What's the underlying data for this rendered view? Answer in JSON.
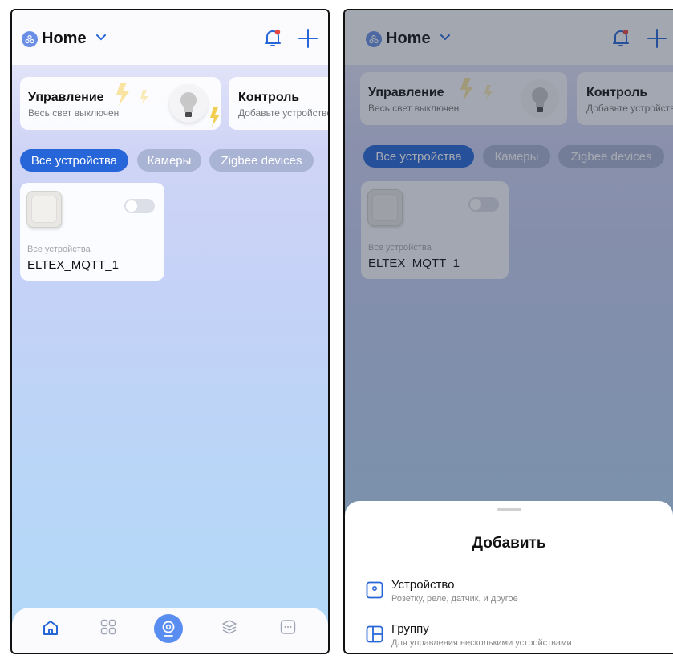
{
  "header": {
    "title": "Home"
  },
  "scene_cards": [
    {
      "title": "Управление",
      "subtitle": "Весь свет выключен"
    },
    {
      "title": "Контроль",
      "subtitle": "Добавьте устройство"
    }
  ],
  "tabs": [
    {
      "label": "Все устройства",
      "active": true
    },
    {
      "label": "Камеры",
      "active": false
    },
    {
      "label": "Zigbee devices",
      "active": false
    }
  ],
  "device": {
    "category": "Все устройства",
    "name": "ELTEX_MQTT_1",
    "on": false
  },
  "bottom_nav": [
    {
      "icon": "home-icon",
      "active": true
    },
    {
      "icon": "grid-icon",
      "active": false
    },
    {
      "icon": "camera-center-icon",
      "active": false
    },
    {
      "icon": "layers-icon",
      "active": false
    },
    {
      "icon": "chat-icon",
      "active": false
    }
  ],
  "add_sheet": {
    "title": "Добавить",
    "options": [
      {
        "title": "Устройство",
        "subtitle": "Розетку, реле, датчик, и другое"
      },
      {
        "title": "Группу",
        "subtitle": "Для управления несколькими устройствами"
      }
    ]
  },
  "colors": {
    "accent": "#2766d8",
    "bell_dot": "#e8453c",
    "plus": "#2766d8"
  }
}
